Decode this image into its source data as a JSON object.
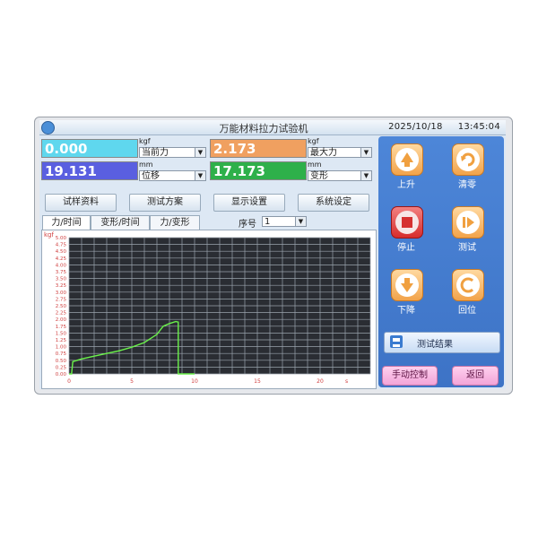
{
  "titlebar": {
    "title": "万能材料拉力试验机",
    "date": "2025/10/18",
    "time": "13:45:04"
  },
  "readouts": [
    {
      "value": "0.000",
      "unit": "kgf",
      "select": "当前力",
      "color": "#5fd7ee",
      "text_color": "#ffffff"
    },
    {
      "value": "19.131",
      "unit": "mm",
      "select": "位移",
      "color": "#5a5fe0",
      "text_color": "#ffffff"
    },
    {
      "value": "2.173",
      "unit": "kgf",
      "select": "最大力",
      "color": "#f0a060",
      "text_color": "#ffffff"
    },
    {
      "value": "17.173",
      "unit": "mm",
      "select": "变形",
      "color": "#2eb04a",
      "text_color": "#ffffff"
    }
  ],
  "menu": [
    "试样资料",
    "测试方案",
    "显示设置",
    "系统设定"
  ],
  "tabs": [
    "力/时间",
    "变形/时间",
    "力/变形"
  ],
  "sequence": {
    "label": "序号",
    "value": "1"
  },
  "controls": {
    "up": "上升",
    "zero": "清零",
    "stop": "停止",
    "test": "测试",
    "down": "下降",
    "return": "回位",
    "result": "测试结果",
    "manual": "手动控制",
    "back": "返回"
  },
  "colors": {
    "accent_panel": "#4a82d4",
    "plot_bg": "#2a2d33",
    "grid": "#9aa3ad",
    "curve": "#6af24a",
    "axis_text": "#d04040"
  },
  "chart_data": {
    "type": "line",
    "ylabel": "kgf",
    "xlabel": "s",
    "xlim": [
      0,
      24
    ],
    "ylim": [
      0,
      5
    ],
    "yticks": [
      "0.00",
      "0.25",
      "0.50",
      "0.75",
      "1.00",
      "1.25",
      "1.50",
      "1.75",
      "2.00",
      "2.25",
      "2.50",
      "2.75",
      "3.00",
      "3.25",
      "3.50",
      "3.75",
      "4.00",
      "4.25",
      "4.50",
      "4.75",
      "5.00"
    ],
    "xticks": [
      "0",
      "5",
      "10",
      "15",
      "20"
    ],
    "grid": true,
    "series": [
      {
        "x": [
          0,
          0.2,
          0.3,
          1.0,
          2.0,
          3.0,
          4.0,
          5.0,
          6.0,
          7.0,
          7.5,
          8.0,
          8.5,
          8.7,
          8.7,
          10.0
        ],
        "y": [
          0,
          0.0,
          0.45,
          0.55,
          0.65,
          0.75,
          0.85,
          0.98,
          1.15,
          1.45,
          1.75,
          1.85,
          1.92,
          1.9,
          0.0,
          0.0
        ]
      }
    ]
  }
}
